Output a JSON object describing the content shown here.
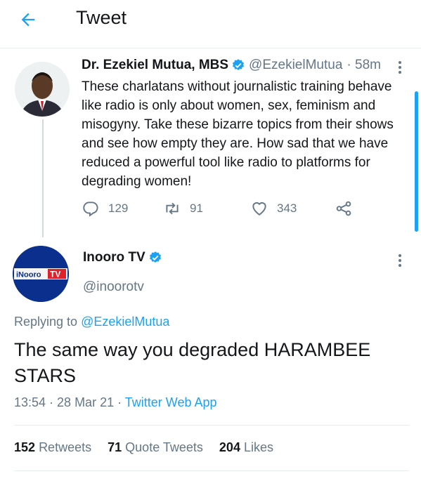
{
  "header": {
    "title": "Tweet"
  },
  "parent_tweet": {
    "author_name": "Dr. Ezekiel Mutua, MBS",
    "handle": "@EzekielMutua",
    "time": "· 58m",
    "text": "These charlatans without journalistic training behave like radio  is only about women, sex, feminism and misogyny. Take these bizarre topics from their shows and see how empty they are. How sad that we have reduced a powerful tool like radio to platforms for degrading women!",
    "replies": "129",
    "retweets": "91",
    "likes": "343"
  },
  "main_tweet": {
    "author_name": "Inooro TV",
    "handle": "@inoorotv",
    "avatar_text": "iNooro",
    "avatar_text2": "TV",
    "replying_prefix": "Replying to",
    "replying_handle": "@EzekielMutua",
    "text": "The same way you degraded HARAMBEE STARS",
    "time": "13:54 · 28 Mar 21 ·",
    "app": "Twitter Web App"
  },
  "stats": {
    "retweets_count": "152",
    "retweets_label": "Retweets",
    "quotes_count": "71",
    "quotes_label": "Quote Tweets",
    "likes_count": "204",
    "likes_label": "Likes"
  },
  "colors": {
    "accent": "#1da1f2",
    "secondary_text": "#657786",
    "avatar2_bg": "#0a2f8c",
    "avatar2_tv": "#e0202a"
  }
}
